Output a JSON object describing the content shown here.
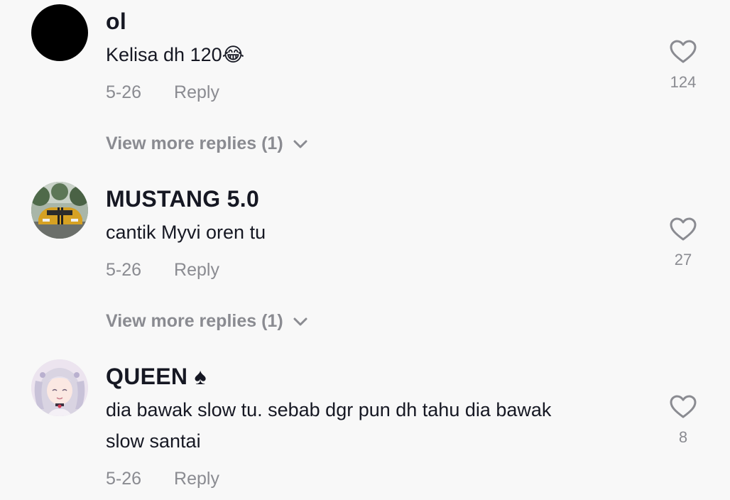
{
  "comments": [
    {
      "username": "ol",
      "text": "Kelisa dh 120😂",
      "date": "5-26",
      "reply_label": "Reply",
      "like_count": "124",
      "view_more": "View more replies (1)"
    },
    {
      "username": "MUSTANG 5.0",
      "text": "cantik Myvi oren tu",
      "date": "5-26",
      "reply_label": "Reply",
      "like_count": "27",
      "view_more": "View more replies (1)"
    },
    {
      "username": "QUEEN ♠",
      "text_line1": "dia bawak slow tu. sebab dgr pun dh tahu dia bawak",
      "text_line2": "slow santai",
      "date": "5-26",
      "reply_label": "Reply",
      "like_count": "8"
    }
  ],
  "icons": {
    "like": "heart-outline-icon",
    "expand": "chevron-down-icon"
  },
  "colors": {
    "background": "#f8f8f8",
    "primary_text": "#161823",
    "secondary_text": "#8a8b91"
  }
}
